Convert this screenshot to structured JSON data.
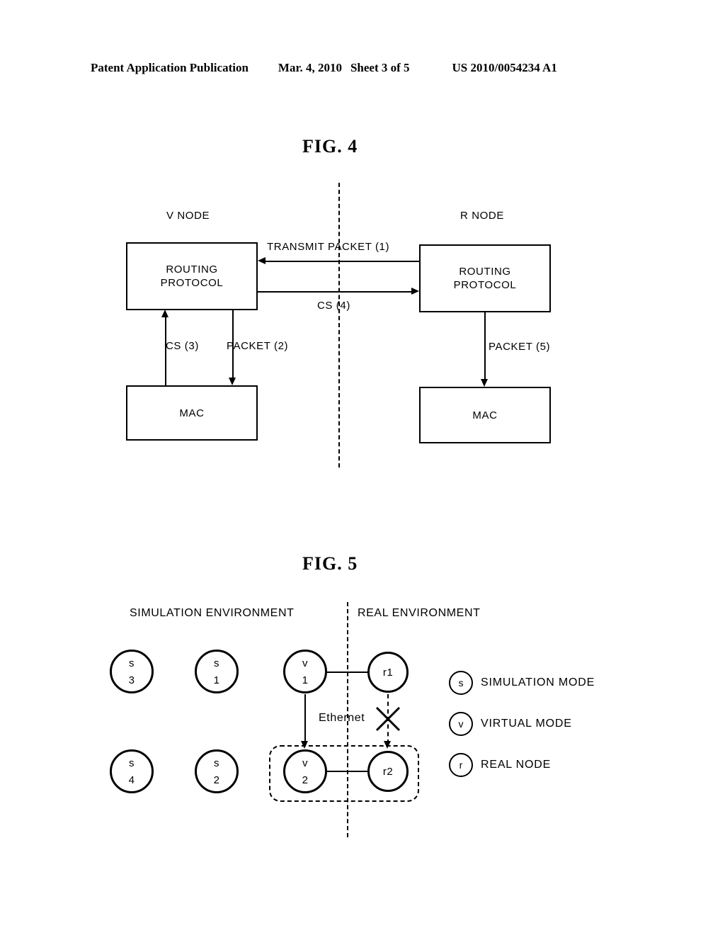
{
  "header": {
    "publication": "Patent Application Publication",
    "date": "Mar. 4, 2010",
    "sheet": "Sheet 3 of 5",
    "patent_number": "US 2010/0054234 A1"
  },
  "fig4": {
    "title": "FIG.  4",
    "left_node_label": "V NODE",
    "right_node_label": "R NODE",
    "boxes": {
      "v_routing": "ROUTING\nPROTOCOL",
      "v_routing_line1": "ROUTING",
      "v_routing_line2": "PROTOCOL",
      "v_mac": "MAC",
      "r_routing_line1": "ROUTING",
      "r_routing_line2": "PROTOCOL",
      "r_mac": "MAC"
    },
    "arrows": {
      "transmit_packet": "TRANSMIT PACKET (1)",
      "cs4": "CS (4)",
      "cs3": "CS (3)",
      "packet2": "PACKET (2)",
      "packet5": "PACKET (5)"
    }
  },
  "fig5": {
    "title": "FIG.  5",
    "left_env_label": "SIMULATION ENVIRONMENT",
    "right_env_label": "REAL ENVIRONMENT",
    "ethernet_label": "Ethernet",
    "nodes": [
      {
        "id": "s3",
        "line1": "s",
        "line2": "3"
      },
      {
        "id": "s1",
        "line1": "s",
        "line2": "1"
      },
      {
        "id": "v1",
        "line1": "v",
        "line2": "1"
      },
      {
        "id": "r1",
        "line1": "r1",
        "line2": ""
      },
      {
        "id": "s4",
        "line1": "s",
        "line2": "4"
      },
      {
        "id": "s2",
        "line1": "s",
        "line2": "2"
      },
      {
        "id": "v2",
        "line1": "v",
        "line2": "2"
      },
      {
        "id": "r2",
        "line1": "r2",
        "line2": ""
      }
    ],
    "legend": [
      {
        "symbol": "s",
        "label": "SIMULATION MODE"
      },
      {
        "symbol": "v",
        "label": "VIRTUAL MODE"
      },
      {
        "symbol": "r",
        "label": "REAL NODE"
      }
    ]
  },
  "colors": {
    "ink": "#000000",
    "paper": "#ffffff"
  }
}
